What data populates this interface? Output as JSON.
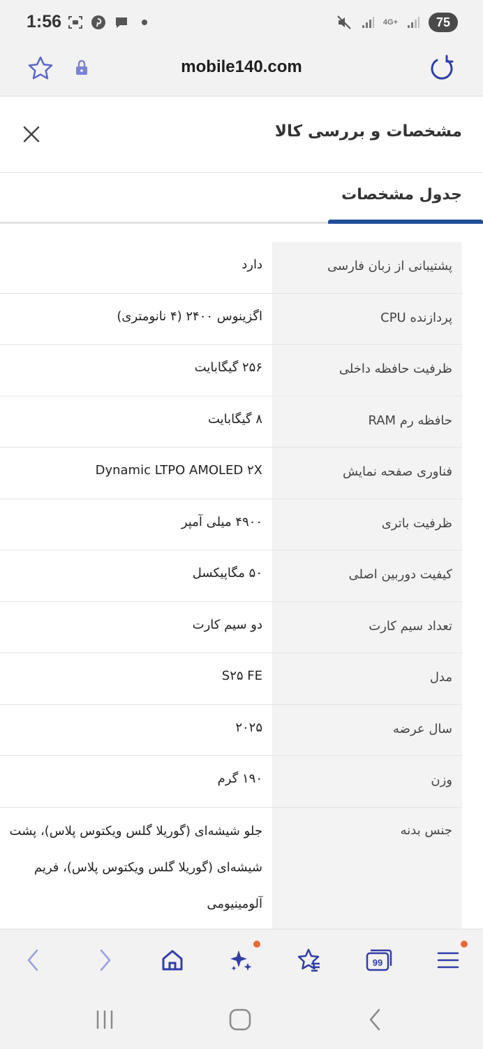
{
  "status_bar": {
    "time": "1:56",
    "battery": "75",
    "network": "4G+"
  },
  "browser": {
    "url": "mobile140.com"
  },
  "header": {
    "title": "مشخصات و بررسی کالا"
  },
  "tabs": [
    {
      "label": "جدول مشخصات",
      "active": true
    }
  ],
  "specs": [
    {
      "label": "پشتیبانی از زبان فارسی",
      "value": "دارد"
    },
    {
      "label": "پردازنده CPU",
      "value": "اگزینوس ۲۴۰۰ (۴ نانومتری)"
    },
    {
      "label": "ظرفیت حافظه داخلی",
      "value": "۲۵۶ گیگابایت"
    },
    {
      "label": "حافظه رم RAM",
      "value": "۸ گیگابایت"
    },
    {
      "label": "فناوری صفحه نمایش",
      "value": "Dynamic LTPO AMOLED ۲X"
    },
    {
      "label": "ظرفیت باتری",
      "value": "۴۹۰۰ میلی آمپر"
    },
    {
      "label": "کیفیت دوربین اصلی",
      "value": "۵۰ مگاپیکسل"
    },
    {
      "label": "تعداد سیم کارت",
      "value": "دو سیم کارت"
    },
    {
      "label": "مدل",
      "value": "S۲۵ FE"
    },
    {
      "label": "سال عرضه",
      "value": "۲۰۲۵"
    },
    {
      "label": "وزن",
      "value": "۱۹۰ گرم"
    },
    {
      "label": "جنس بدنه",
      "value": "جلو شیشه‌ای (گوریلا گلس ویکتوس پلاس)، پشت شیشه‌ای (گوریلا گلس ویکتوس پلاس)، فریم آلومینیومی"
    }
  ],
  "toolbar": {
    "icons": [
      "back-icon",
      "forward-icon",
      "home-icon",
      "sparkle-icon",
      "bookmark-star-icon",
      "tabs-count-icon",
      "menu-icon"
    ],
    "tabs_count": "99",
    "accent_color": "#2f3ea8",
    "badge_color": "#f26a2e"
  }
}
